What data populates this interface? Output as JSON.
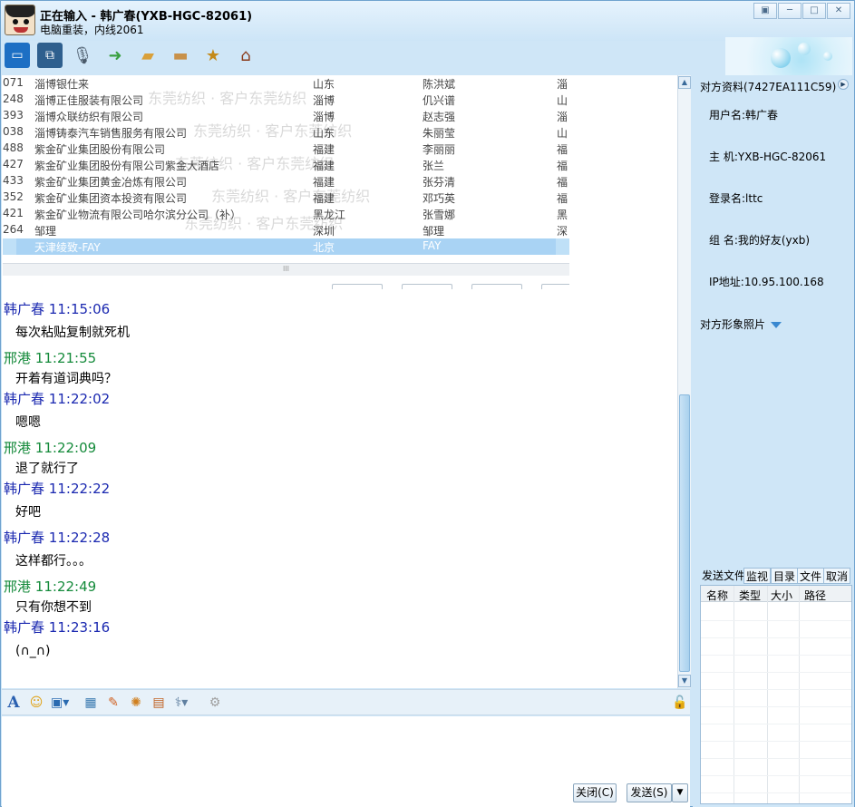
{
  "window": {
    "title": "正在输入 - 韩广春(YXB-HGC-82061)",
    "subtitle": "电脑重装，内线2061"
  },
  "colors": {
    "peer_name": "#1a28b0",
    "self_name": "#148a3a",
    "frame": "#cfe6f7"
  },
  "toolbar": {
    "icons": [
      "monitor-icon",
      "remote-assist-icon",
      "microphone-icon",
      "send-file-icon",
      "folder-share-icon",
      "folder-open-icon",
      "star-puzzle-icon",
      "home-icon"
    ]
  },
  "screenshot_table": {
    "rows": [
      {
        "id": "071",
        "company": "淄博银仕来",
        "province": "山东",
        "contact": "陈洪斌",
        "tail": "淄"
      },
      {
        "id": "248",
        "company": "淄博正佳服装有限公司",
        "province": "淄博",
        "contact": "仉兴谱",
        "tail": "山"
      },
      {
        "id": "393",
        "company": "淄博众联纺织有限公司",
        "province": "淄博",
        "contact": "赵志强",
        "tail": "淄"
      },
      {
        "id": "038",
        "company": "淄博铸泰汽车销售服务有限公司",
        "province": "山东",
        "contact": "朱丽莹",
        "tail": "山"
      },
      {
        "id": "488",
        "company": "紫金矿业集团股份有限公司",
        "province": "福建",
        "contact": "李丽丽",
        "tail": "福"
      },
      {
        "id": "427",
        "company": "紫金矿业集团股份有限公司紫金大酒店",
        "province": "福建",
        "contact": "张兰",
        "tail": "福"
      },
      {
        "id": "433",
        "company": "紫金矿业集团黄金冶炼有限公司",
        "province": "福建",
        "contact": "张芬清",
        "tail": "福"
      },
      {
        "id": "352",
        "company": "紫金矿业集团资本投资有限公司",
        "province": "福建",
        "contact": "邓巧英",
        "tail": "福"
      },
      {
        "id": "421",
        "company": "紫金矿业物流有限公司哈尔滨分公司（补）",
        "province": "黑龙江",
        "contact": "张雪娜",
        "tail": "黑"
      },
      {
        "id": "264",
        "company": "邹理",
        "province": "深圳",
        "contact": "邹理",
        "tail": "深"
      },
      {
        "id": "",
        "company": "天津绫致-FAY",
        "province": "北京",
        "contact": "FAY",
        "tail": ""
      }
    ],
    "watermark": "东莞纺织 · 客户东莞纺织",
    "scroll_grip": "III"
  },
  "messages": [
    {
      "sender": "韩广春",
      "time": "11:15:06",
      "text": "每次粘贴复制就死机",
      "side": "peer"
    },
    {
      "sender": "邢港",
      "time": "11:21:55",
      "text": "开着有道词典吗？",
      "side": "self"
    },
    {
      "sender": "韩广春",
      "time": "11:22:02",
      "text": "嗯嗯",
      "side": "peer"
    },
    {
      "sender": "邢港",
      "time": "11:22:09",
      "text": "退了就行了",
      "side": "self"
    },
    {
      "sender": "韩广春",
      "time": "11:22:22",
      "text": "好吧",
      "side": "peer"
    },
    {
      "sender": "韩广春",
      "time": "11:22:28",
      "text": "这样都行。。。",
      "side": "peer"
    },
    {
      "sender": "邢港",
      "time": "11:22:49",
      "text": "只有你想不到",
      "side": "self"
    },
    {
      "sender": "韩广春",
      "time": "11:23:16",
      "text": "(∩_∩)",
      "side": "peer"
    }
  ],
  "input_toolbar": {
    "icons": [
      "font-icon",
      "emoji-icon",
      "screen-capture-icon",
      "image-icon",
      "handwriting-icon",
      "cookie-icon",
      "calendar-icon",
      "stethoscope-icon",
      "misc-icon",
      "lock-icon"
    ]
  },
  "buttons": {
    "close": "关闭(C)",
    "send": "发送(S)"
  },
  "profile": {
    "header": "对方资料(7427EA111C59)",
    "username": "用户名:韩广春",
    "host": "主  机:YXB-HGC-82061",
    "login": "登录名:lttc",
    "group": "组  名:我的好友(yxb)",
    "ip": "IP地址:10.95.100.168",
    "photo_label": "对方形象照片"
  },
  "file_panel": {
    "label": "发送文件",
    "tabs": [
      "监视",
      "目录",
      "文件",
      "取消"
    ],
    "columns": [
      "名称",
      "类型",
      "大小",
      "路径"
    ]
  }
}
